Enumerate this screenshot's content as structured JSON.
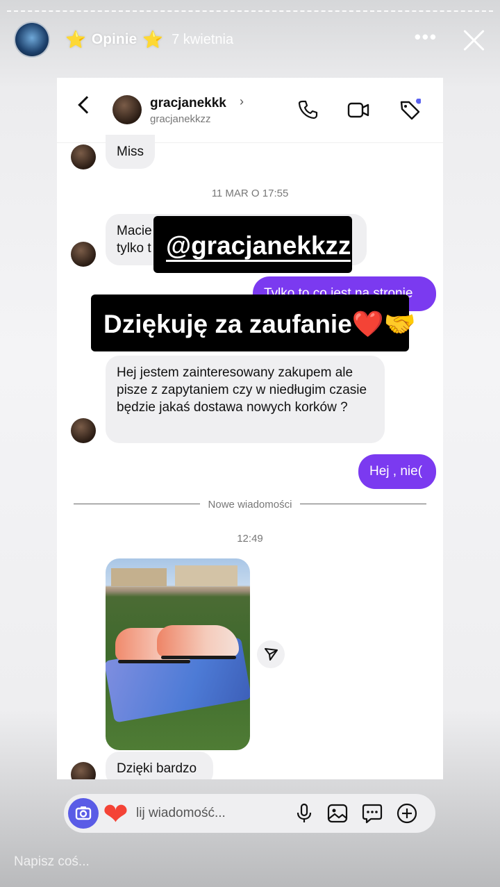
{
  "story": {
    "title": "Opinie",
    "star": "⭐",
    "date": "7 kwietnia",
    "more": "•••",
    "reply_placeholder": "Napisz coś..."
  },
  "chat": {
    "header": {
      "name": "gracjanekkk",
      "chevron": "›",
      "username": "gracjanekkzz"
    },
    "messages": {
      "miss": "Miss",
      "ts1": "11 MAR O 17:55",
      "macie_line1": "Macie",
      "macie_line2": "tylko t",
      "tylko": "Tylko to co jest na stronie",
      "question": "Hej jestem zainteresowany zakupem ale pisze z zapytaniem czy w niedługim czasie będzie jakaś dostawa nowych korków ?",
      "reply_nie": "Hej , nie(",
      "new_messages": "Nowe wiadomości",
      "ts2": "12:49",
      "thanks_msg": "Dzięki bardzo"
    },
    "composer": {
      "placeholder": "lij wiadomość..."
    }
  },
  "stickers": {
    "mention": "@gracjanekkzz",
    "thanks": "Dziękuję za zaufanie❤️🤝"
  },
  "colors": {
    "accent": "#7b3af0",
    "incoming": "#efeff1",
    "camera": "#5a5ce6"
  }
}
